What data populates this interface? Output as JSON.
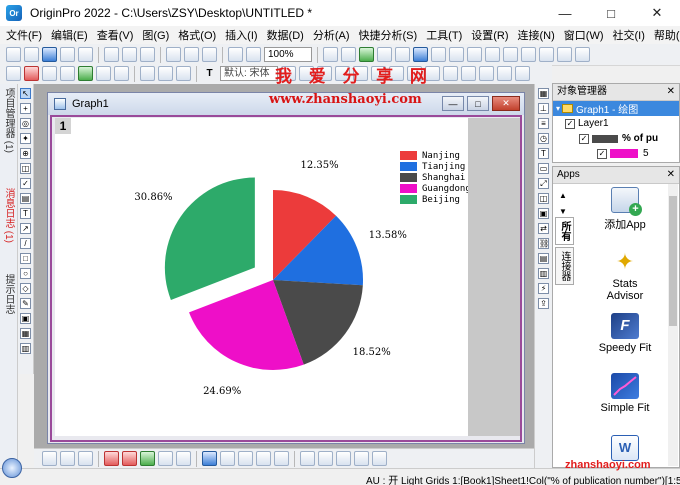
{
  "window": {
    "title": "OriginPro 2022 - C:\\Users\\ZSY\\Desktop\\UNTITLED *",
    "app_icon_text": "Or"
  },
  "menu": [
    "文件(F)",
    "编辑(E)",
    "查看(V)",
    "图(G)",
    "格式(O)",
    "插入(I)",
    "数据(D)",
    "分析(A)",
    "快捷分析(S)",
    "工具(T)",
    "设置(R)",
    "连接(N)",
    "窗口(W)",
    "社交(I)",
    "帮助(H)"
  ],
  "toolbar": {
    "zoom": "100%",
    "font_family": "默认: 宋体"
  },
  "left_panels": [
    "项目管理器 (1)",
    "消息日志 (1)",
    "提示日志"
  ],
  "graph_window": {
    "title": "Graph1",
    "layer_number": "1"
  },
  "watermark": {
    "cn": "我 爱 分 享 网",
    "url": "www.zhanshaoyi.com",
    "url_bottom": "zhanshaoyi.com"
  },
  "chart_data": {
    "type": "pie",
    "categories": [
      "Nanjing",
      "Tianjing",
      "Shanghai",
      "Guangdong",
      "Beijing"
    ],
    "values": [
      12.35,
      13.58,
      18.52,
      24.69,
      30.86
    ],
    "value_labels": [
      "12.35%",
      "13.58%",
      "18.52%",
      "24.69%",
      "30.86%"
    ],
    "colors": [
      "#ec3b3b",
      "#1f6fe0",
      "#4a4a4a",
      "#ee0fc8",
      "#2daa6a"
    ],
    "exploded": [
      false,
      false,
      false,
      false,
      true
    ],
    "start": "12 o'clock",
    "direction": "clockwise",
    "legend_position": "top-right",
    "title": ""
  },
  "object_manager": {
    "title": "对象管理器",
    "graph_node": "Graph1 - 绘图",
    "layer_node": "Layer1",
    "plot_node": "% of pu",
    "sub_node": "5"
  },
  "apps_panel": {
    "title": "Apps",
    "tabs": [
      "所有",
      "连接器"
    ],
    "items": [
      "添加App",
      "Stats Advisor",
      "Speedy Fit",
      "Simple Fit"
    ]
  },
  "status": {
    "text": "AU : 开  Light Grids  1:[Book1]Sheet1!Col(\"% of publication number\")[1:5]"
  }
}
